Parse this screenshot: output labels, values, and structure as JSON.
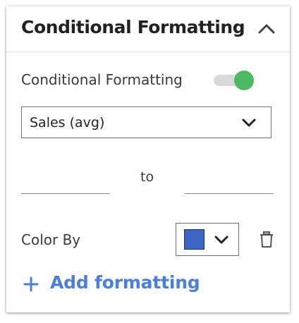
{
  "panel": {
    "title": "Conditional Formatting",
    "collapse_icon": "chevron-up-icon"
  },
  "toggle": {
    "label": "Conditional Formatting",
    "enabled": true,
    "on_color": "#4cb963"
  },
  "field_select": {
    "selected": "Sales (avg)",
    "icon": "chevron-down-icon"
  },
  "range": {
    "min_value": "",
    "separator": "to",
    "max_value": ""
  },
  "color_by": {
    "label": "Color By",
    "swatch_color": "#3b63c4",
    "dropdown_icon": "chevron-down-icon",
    "delete_icon": "trash-icon"
  },
  "add_button": {
    "icon": "plus-icon",
    "label": "Add formatting",
    "color": "#4a7ee0"
  }
}
